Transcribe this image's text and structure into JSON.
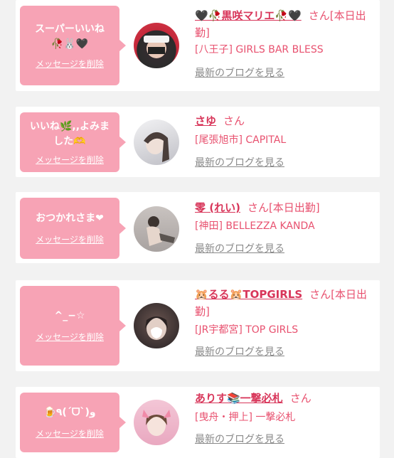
{
  "delete_label": "メッセージを削除",
  "blog_label": "最新のブログを見る",
  "cards": [
    {
      "message": "スーパーいいね🥀🐰🖤",
      "name": "🖤🥀黒咲マリエ🥀🖤",
      "suffix": "さん[本日出勤]",
      "shop": "[八王子] GIRLS BAR BLESS"
    },
    {
      "message": "いいね🌿,,よみました🫶",
      "name": "さゆ",
      "suffix": "さん",
      "shop": "[尾張旭市] CAPITAL"
    },
    {
      "message": "おつかれさま❤",
      "name": "零 (れい)",
      "suffix": "さん[本日出勤]",
      "shop": "[神田] BELLEZZA KANDA"
    },
    {
      "message": "^_−☆",
      "name": "🐹るる🐹TOPGIRLS",
      "suffix": "さん[本日出勤]",
      "shop": "[JR宇都宮] TOP GIRLS"
    },
    {
      "message": "🍺٩(ˊᗜˋ)و",
      "name": "ありす📚一撃必札",
      "suffix": "さん",
      "shop": "[曳舟・押上] 一撃必札"
    }
  ]
}
